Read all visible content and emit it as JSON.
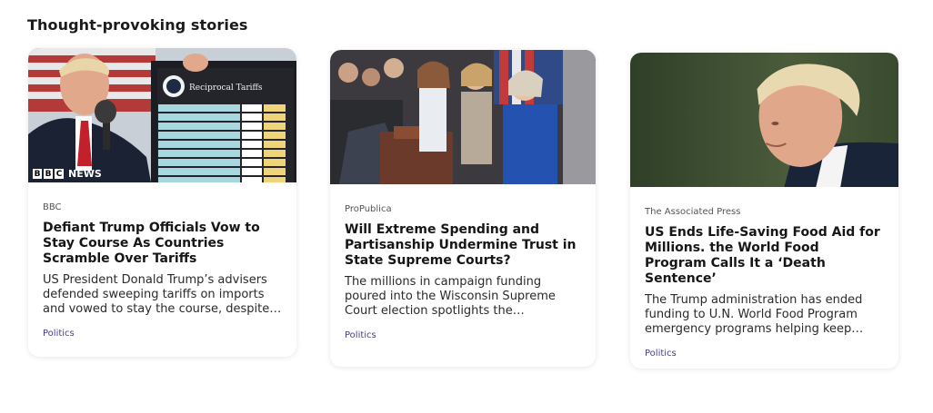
{
  "section": {
    "title": "Thought-provoking stories"
  },
  "cards": [
    {
      "source": "BBC",
      "headline": "Defiant Trump Officials Vow to Stay Course As Countries Scramble Over Tariffs",
      "snippet": "US President Donald Trump’s advisers defended sweeping tariffs on imports and vowed to stay the course, despite…",
      "category": "Politics",
      "image_text": {
        "logo_letters": [
          "B",
          "B",
          "C"
        ],
        "logo_word": "NEWS",
        "chart_title": "Reciprocal Tariffs"
      }
    },
    {
      "source": "ProPublica",
      "headline": "Will Extreme Spending and Partisanship Undermine Trust in State Supreme Courts?",
      "snippet": "The millions in campaign funding poured into the Wisconsin Supreme Court election spotlights the increasing…",
      "category": "Politics"
    },
    {
      "source": "The Associated Press",
      "headline": "US Ends Life-Saving Food Aid for Millions. the World Food Program Calls It a ‘Death Sentence’",
      "snippet": "The Trump administration has ended funding to U.N. World Food Program emergency programs helping keep…",
      "category": "Politics"
    }
  ],
  "colors": {
    "category_link": "#4b3a9a",
    "card_background": "#ffffff"
  }
}
